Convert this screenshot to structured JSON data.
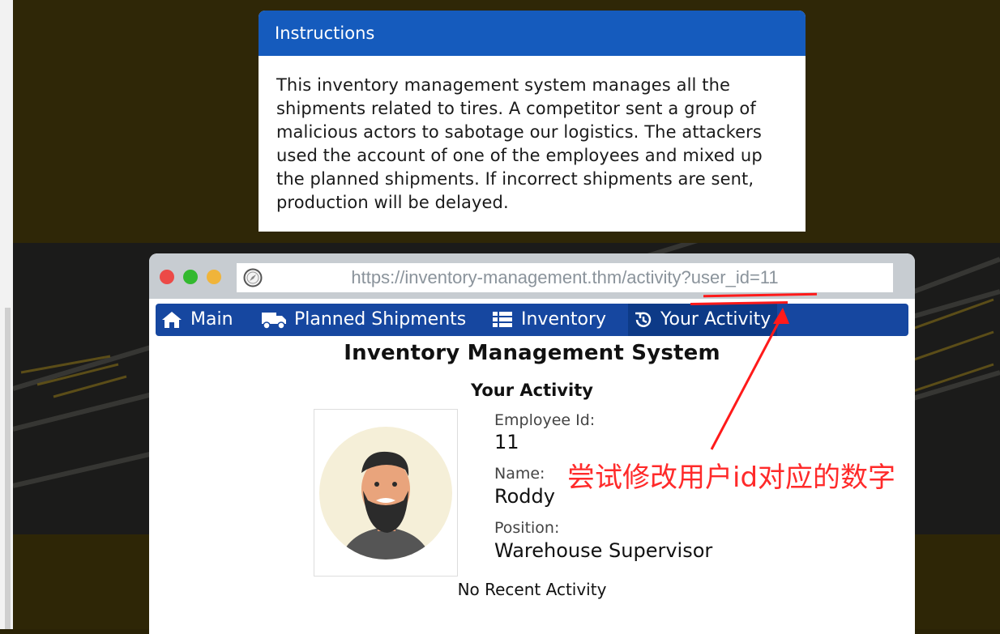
{
  "instructions": {
    "title": "Instructions",
    "body": "This inventory management system manages all the shipments related to tires. A competitor sent a group of malicious actors to sabotage our logistics. The attackers used the account of one of the employees and mixed up the planned shipments. If incorrect shipments are sent, production will be delayed."
  },
  "browser": {
    "url": "https://inventory-management.thm/activity?user_id=11",
    "window_buttons": [
      "close",
      "minimize",
      "maximize"
    ]
  },
  "nav": {
    "items": [
      {
        "label": "Main",
        "icon": "home-icon"
      },
      {
        "label": "Planned Shipments",
        "icon": "truck-icon"
      },
      {
        "label": "Inventory",
        "icon": "list-icon"
      },
      {
        "label": "Your Activity",
        "icon": "history-icon",
        "active": true
      }
    ]
  },
  "page": {
    "title": "Inventory Management System",
    "subtitle": "Your Activity",
    "employee_id_label": "Employee Id:",
    "employee_id": "11",
    "name_label": "Name:",
    "name": "Roddy",
    "position_label": "Position:",
    "position": "Warehouse Supervisor",
    "no_activity": "No Recent Activity"
  },
  "annotation": {
    "text": "尝试修改用户id对应的数字",
    "color": "#ff2a2a"
  },
  "colors": {
    "header_blue": "#155bbd",
    "nav_blue": "#1647a0",
    "nav_active": "#0d3a87",
    "annotation_red": "#ff2a2a"
  }
}
